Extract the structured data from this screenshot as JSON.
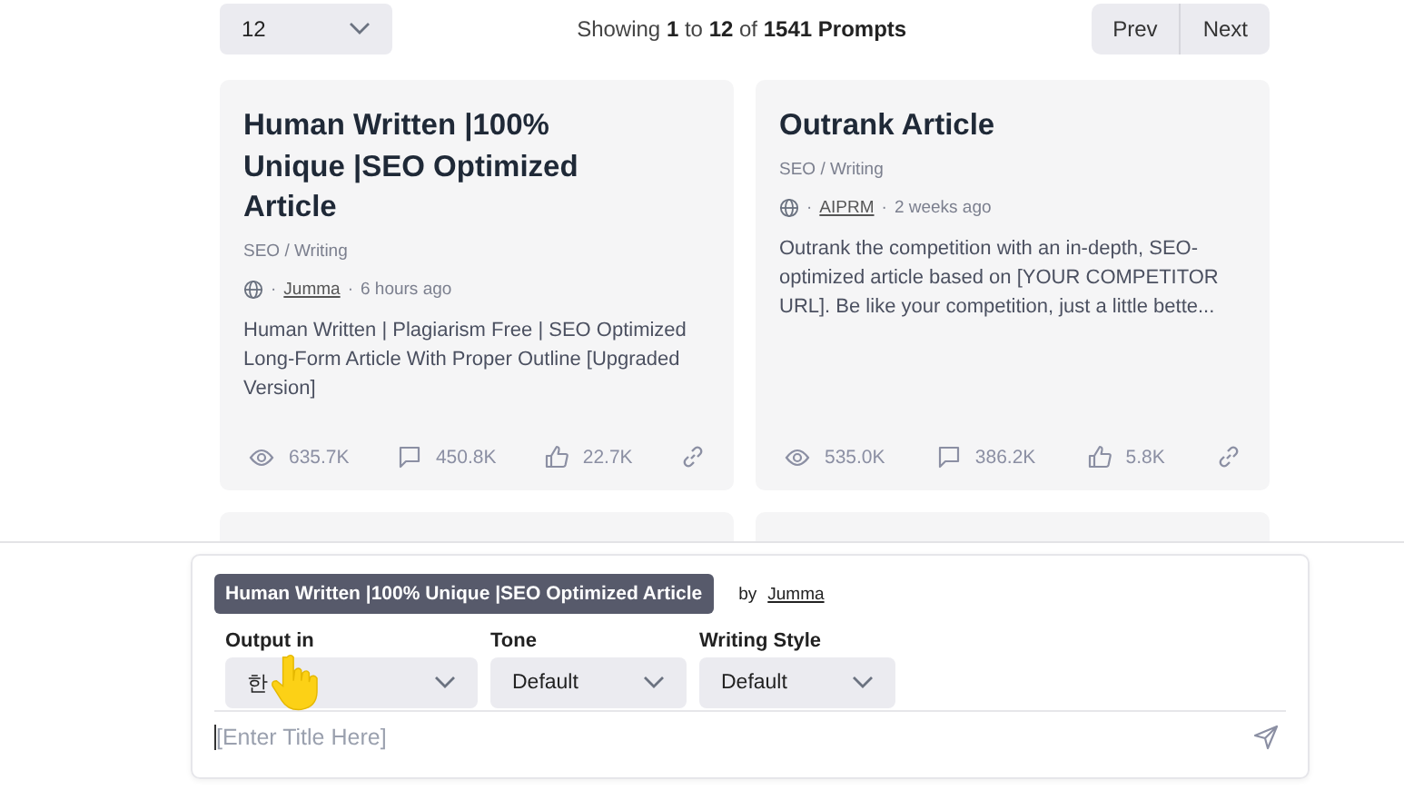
{
  "pager": {
    "per_page": "12",
    "summary": "Showing **1** to **12** of **1541 Prompts**",
    "buttons": [
      "Prev",
      "Next"
    ]
  },
  "separator": "·",
  "cards": [
    {
      "title": "Human Written |100% Unique |SEO Optimized Article",
      "category": "SEO / Writing",
      "author": "Jumma",
      "time": "6 hours ago",
      "description": "Human Written | Plagiarism Free | SEO Optimized Long-Form Article With Proper Outline [Upgraded Version]",
      "views": "635.7K",
      "comments": "450.8K",
      "likes": "22.7K"
    },
    {
      "title": "Outrank Article",
      "category": "SEO / Writing",
      "author": "AIPRM",
      "time": "2 weeks ago",
      "description": "Outrank the competition with an in-depth, SEO-optimized article based on [YOUR COMPETITOR URL]. Be like your competition, just a little bette...",
      "views": "535.0K",
      "comments": "386.2K",
      "likes": "5.8K"
    }
  ],
  "composer": {
    "prompt_title": "Human Written |100% Unique |SEO Optimized Article",
    "by": "by",
    "author": "Jumma",
    "selects": [
      {
        "label": "Output in",
        "value": "한"
      },
      {
        "label": "Tone",
        "value": "Default"
      },
      {
        "label": "Writing Style",
        "value": "Default"
      }
    ],
    "placeholder": "[Enter Title Here]"
  }
}
